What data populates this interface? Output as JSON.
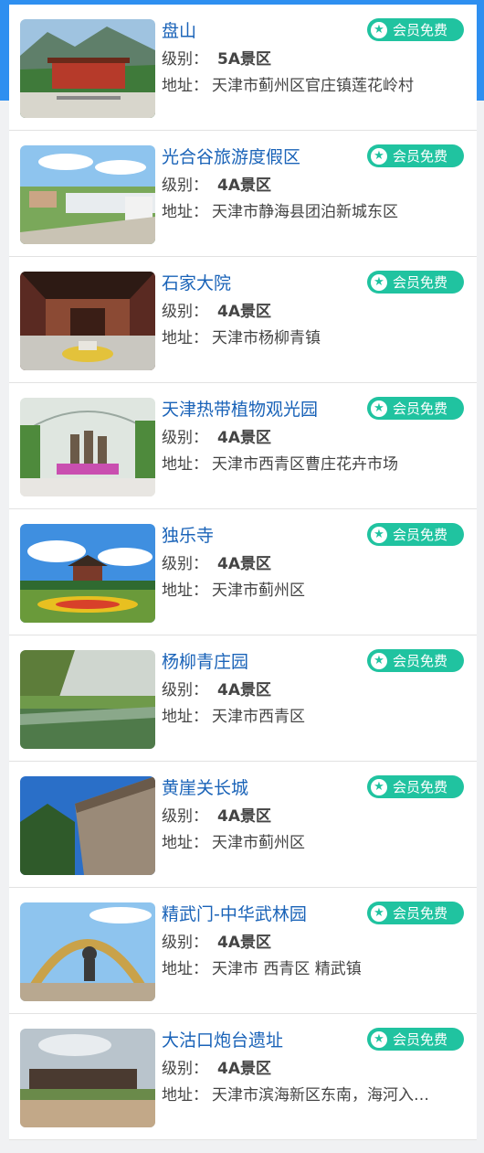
{
  "labels": {
    "level": "级别：",
    "address": "地址：",
    "badge": "会员免费"
  },
  "colors": {
    "title": "#1a63b8",
    "badge": "#20c3a0",
    "header": "#2e8ff0"
  },
  "items": [
    {
      "name": "盘山",
      "level": "5A景区",
      "address": "天津市蓟州区官庄镇莲花岭村"
    },
    {
      "name": "光合谷旅游度假区",
      "level": "4A景区",
      "address": "天津市静海县团泊新城东区"
    },
    {
      "name": "石家大院",
      "level": "4A景区",
      "address": "天津市杨柳青镇"
    },
    {
      "name": "天津热带植物观光园",
      "level": "4A景区",
      "address": "天津市西青区曹庄花卉市场"
    },
    {
      "name": "独乐寺",
      "level": "4A景区",
      "address": "天津市蓟州区"
    },
    {
      "name": "杨柳青庄园",
      "level": "4A景区",
      "address": "天津市西青区"
    },
    {
      "name": "黄崖关长城",
      "level": "4A景区",
      "address": "天津市蓟州区"
    },
    {
      "name": "精武门-中华武林园",
      "level": "4A景区",
      "address": "天津市 西青区 精武镇"
    },
    {
      "name": "大沽口炮台遗址",
      "level": "4A景区",
      "address": "天津市滨海新区东南，海河入…"
    }
  ]
}
